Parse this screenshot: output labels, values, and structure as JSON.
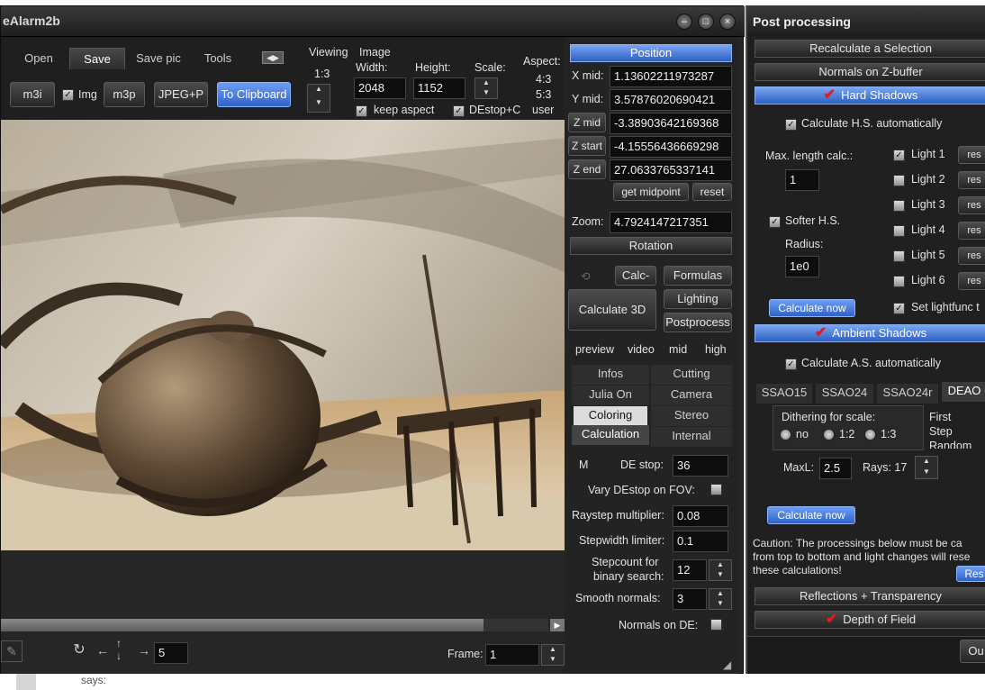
{
  "window": {
    "title": "eAlarm2b"
  },
  "toolbar": {
    "tabs": [
      "Open",
      "Save",
      "Save pic",
      "Tools"
    ],
    "buttons": {
      "m3i": "m3i",
      "img": "Img",
      "m3p": "m3p",
      "jpeg": "JPEG+P",
      "clipboard": "To Clipboard"
    },
    "viewing_label": "Viewing",
    "viewing_value": "1:3",
    "image_label": "Image",
    "width_label": "Width:",
    "width_value": "2048",
    "height_label": "Height:",
    "height_value": "1152",
    "scale_label": "Scale:",
    "aspect_label": "Aspect:",
    "aspect_options": [
      "4:3",
      "5:3",
      "user"
    ],
    "keep_aspect": "keep aspect",
    "destop": "DEstop+C"
  },
  "position": {
    "header": "Position",
    "xmid_label": "X mid:",
    "xmid": "1.13602211973287",
    "ymid_label": "Y mid:",
    "ymid": "3.57876020690421",
    "zmid_label": "Z mid",
    "zmid": "-3.38903642169368",
    "zstart_label": "Z start",
    "zstart": "-4.15556436669298",
    "zend_label": "Z end",
    "zend": "27.0633765337141",
    "get_midpoint": "get midpoint",
    "reset": "reset",
    "zoom_label": "Zoom:",
    "zoom": "4.7924147217351",
    "rotation": "Rotation"
  },
  "controls": {
    "calc_minus": "Calc-",
    "formulas": "Formulas",
    "calculate3d": "Calculate 3D",
    "lighting": "Lighting",
    "postprocess": "Postprocess",
    "preview": "preview",
    "video": "video",
    "mid": "mid",
    "high": "high",
    "tabs1": [
      "Infos",
      "Cutting"
    ],
    "tabs2": [
      "Julia On",
      "Camera"
    ],
    "tabs3": [
      "Coloring",
      "Stereo"
    ],
    "tabs4": [
      "Calculation",
      "Internal"
    ],
    "m_label": "M",
    "destop_label": "DE stop:",
    "destop_value": "36",
    "vary_label": "Vary DEstop on FOV:",
    "raystep_label": "Raystep multiplier:",
    "raystep_value": "0.08",
    "stepwidth_label": "Stepwidth limiter:",
    "stepwidth_value": "0.1",
    "stepcount_label1": "Stepcount for",
    "stepcount_label2": "binary search:",
    "stepcount_value": "12",
    "smooth_label": "Smooth  normals:",
    "smooth_value": "3",
    "normals_label": "Normals on DE:"
  },
  "viewer_bottom": {
    "step_value": "5",
    "frame_label": "Frame:",
    "frame_value": "1"
  },
  "postproc": {
    "title": "Post processing",
    "recalc_selection": "Recalculate a Selection",
    "normals_zbuffer": "Normals on Z-buffer",
    "hard_shadows": "Hard Shadows",
    "calc_hs_auto": "Calculate H.S. automatically",
    "max_length_label": "Max. length calc.:",
    "max_length_value": "1",
    "lights": [
      "Light 1",
      "Light 2",
      "Light 3",
      "Light 4",
      "Light 5",
      "Light 6"
    ],
    "reset_short": "res",
    "softer_hs": "Softer H.S.",
    "radius_label": "Radius:",
    "radius_value": "1e0",
    "calculate_now": "Calculate now",
    "set_lightfunc": "Set lightfunc t",
    "ambient_shadows": "Ambient Shadows",
    "calc_as_auto": "Calculate A.S. automatically",
    "as_tabs": [
      "SSAO15",
      "SSAO24",
      "SSAO24r",
      "DEAO"
    ],
    "dithering_label": "Dithering for scale:",
    "dither_options": [
      "no",
      "1:2",
      "1:3"
    ],
    "first_label": "First",
    "step_label": "Step",
    "random_label": "Random",
    "maxl_label": "MaxL:",
    "maxl_value": "2.5",
    "rays_label": "Rays: 17",
    "calculate_now2": "Calculate now",
    "caution1": "Caution:  The processings below must be ca",
    "caution2": "from top to bottom and light changes will rese",
    "caution3": "these calculations!",
    "reset_btn": "Res",
    "reflections": "Reflections + Transparency",
    "depth_of_field": "Depth of Field",
    "out_btn": "Ou"
  },
  "footer_text": "says:"
}
